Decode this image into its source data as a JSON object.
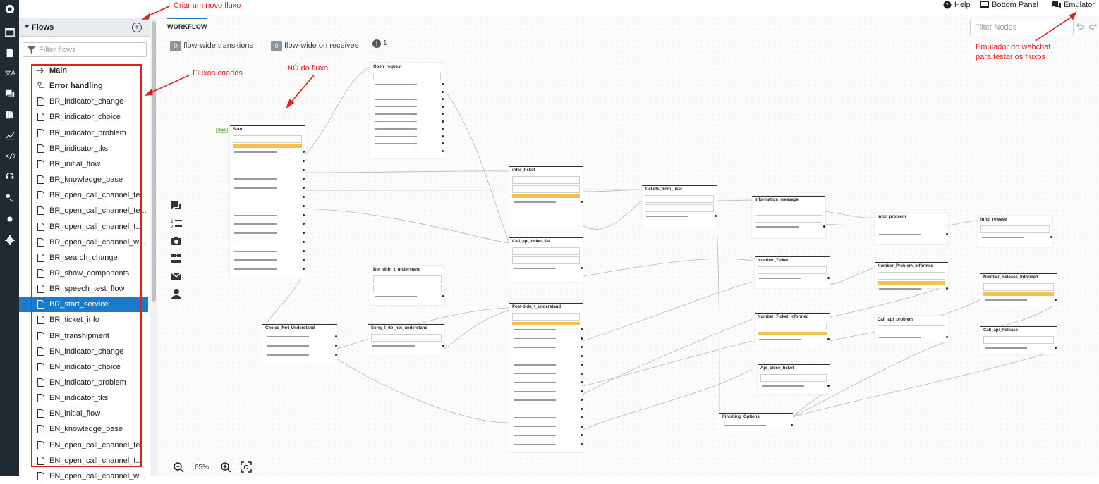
{
  "sidebar_icons": [
    "logo-icon",
    "dashboard-icon",
    "content-icon",
    "translate-icon",
    "chat-icon",
    "library-icon",
    "analytics-icon",
    "code-icon",
    "support-icon",
    "nlu-icon",
    "dot-icon",
    "settings-icon"
  ],
  "flows_panel": {
    "title": "Flows",
    "filter_placeholder": "Filter flows",
    "items": [
      {
        "label": "Main",
        "icon": "main-flow-icon",
        "bold": true
      },
      {
        "label": "Error handling",
        "icon": "error-flow-icon",
        "bold": true
      },
      {
        "label": "BR_indicator_change",
        "icon": "file-icon"
      },
      {
        "label": "BR_indicator_choice",
        "icon": "file-icon"
      },
      {
        "label": "BR_indicator_problem",
        "icon": "file-icon"
      },
      {
        "label": "BR_indicator_tks",
        "icon": "file-icon"
      },
      {
        "label": "BR_initial_flow",
        "icon": "file-icon"
      },
      {
        "label": "BR_knowledge_base",
        "icon": "file-icon"
      },
      {
        "label": "BR_open_call_channel_te...",
        "icon": "file-icon"
      },
      {
        "label": "BR_open_call_channel_te...",
        "icon": "file-icon"
      },
      {
        "label": "BR_open_call_channel_t...",
        "icon": "file-icon"
      },
      {
        "label": "BR_open_call_channel_w...",
        "icon": "file-icon"
      },
      {
        "label": "BR_search_change",
        "icon": "file-icon"
      },
      {
        "label": "BR_show_components",
        "icon": "file-icon"
      },
      {
        "label": "BR_speech_test_flow",
        "icon": "file-icon"
      },
      {
        "label": "BR_start_service",
        "icon": "file-icon",
        "selected": true
      },
      {
        "label": "BR_ticket_info",
        "icon": "file-icon"
      },
      {
        "label": "BR_transhipment",
        "icon": "file-icon"
      },
      {
        "label": "EN_indicator_change",
        "icon": "file-icon"
      },
      {
        "label": "EN_indicator_choice",
        "icon": "file-icon"
      },
      {
        "label": "EN_indicator_problem",
        "icon": "file-icon"
      },
      {
        "label": "EN_indicator_tks",
        "icon": "file-icon"
      },
      {
        "label": "EN_initial_flow",
        "icon": "file-icon"
      },
      {
        "label": "EN_knowledge_base",
        "icon": "file-icon"
      },
      {
        "label": "EN_open_call_channel_te...",
        "icon": "file-icon"
      },
      {
        "label": "EN_open_call_channel_t...",
        "icon": "file-icon"
      },
      {
        "label": "EN_open_call_channel_w...",
        "icon": "file-icon"
      }
    ]
  },
  "topbar": {
    "help": "Help",
    "bottom_panel": "Bottom Panel",
    "emulator": "Emulator"
  },
  "workflow": {
    "tab": "WORKFLOW",
    "flow_wide_transitions_count": "0",
    "flow_wide_transitions_label": "flow-wide transitions",
    "flow_wide_receives_count": "0",
    "flow_wide_receives_label": "flow-wide on receives",
    "info_count": "1",
    "filter_nodes_placeholder": "Filter Nodes",
    "zoom_level": "65%"
  },
  "annotations": {
    "new_flow": "Criar um novo fluxo",
    "created_flows": "Fluxos criados",
    "flow_node": "NÓ do fluxo",
    "emulator_line1": "Emulador do webchat",
    "emulator_line2": "para testar os fluxos"
  },
  "graph": {
    "start_tag": "Start",
    "nodes": [
      {
        "title": "Start"
      },
      {
        "title": "Open_request"
      },
      {
        "title": "infor_ticket"
      },
      {
        "title": "Call_api_ticket_list"
      },
      {
        "title": "Tickets_from_user"
      },
      {
        "title": "Information_message"
      },
      {
        "title": "Number_Ticket"
      },
      {
        "title": "Number_Ticket_Informed"
      },
      {
        "title": "Api_close_ticket"
      },
      {
        "title": "Finishing_Options"
      },
      {
        "title": "infor_problem"
      },
      {
        "title": "Number_Problem_Informed"
      },
      {
        "title": "Call_api_problem"
      },
      {
        "title": "infor_release"
      },
      {
        "title": "Number_Release_Informed"
      },
      {
        "title": "Call_api_Release"
      },
      {
        "title": "Bot_didn_t_understand"
      },
      {
        "title": "Sorry_I_do_not_understand"
      },
      {
        "title": "Choice_Not_Understand"
      },
      {
        "title": "Post-didn_t_understand"
      }
    ]
  }
}
